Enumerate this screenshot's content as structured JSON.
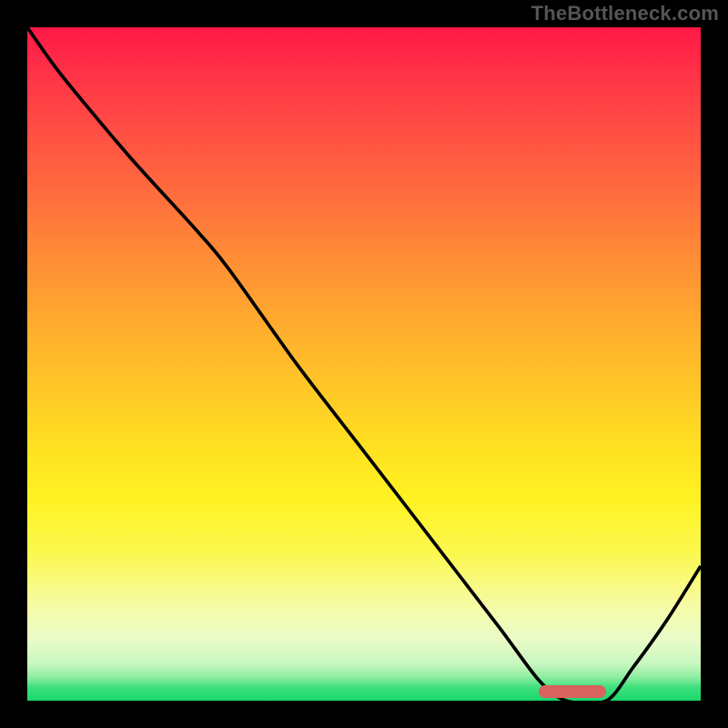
{
  "watermark": "TheBottleneck.com",
  "chart_data": {
    "type": "line",
    "title": "",
    "xlabel": "",
    "ylabel": "",
    "xlim": [
      0,
      100
    ],
    "ylim": [
      0,
      100
    ],
    "x": [
      0,
      5,
      15,
      25,
      30,
      40,
      50,
      60,
      70,
      76,
      80,
      86,
      90,
      95,
      100
    ],
    "values": [
      100,
      93,
      81,
      70,
      64,
      50,
      37,
      24,
      11,
      3,
      0,
      0,
      5,
      12,
      20
    ],
    "marker": {
      "x_start": 76,
      "x_end": 86,
      "y": 1.4
    },
    "marker_color": "#d9625f",
    "curve_color": "#000000",
    "gradient_top": "#ff1846",
    "gradient_bottom": "#17d66a"
  }
}
